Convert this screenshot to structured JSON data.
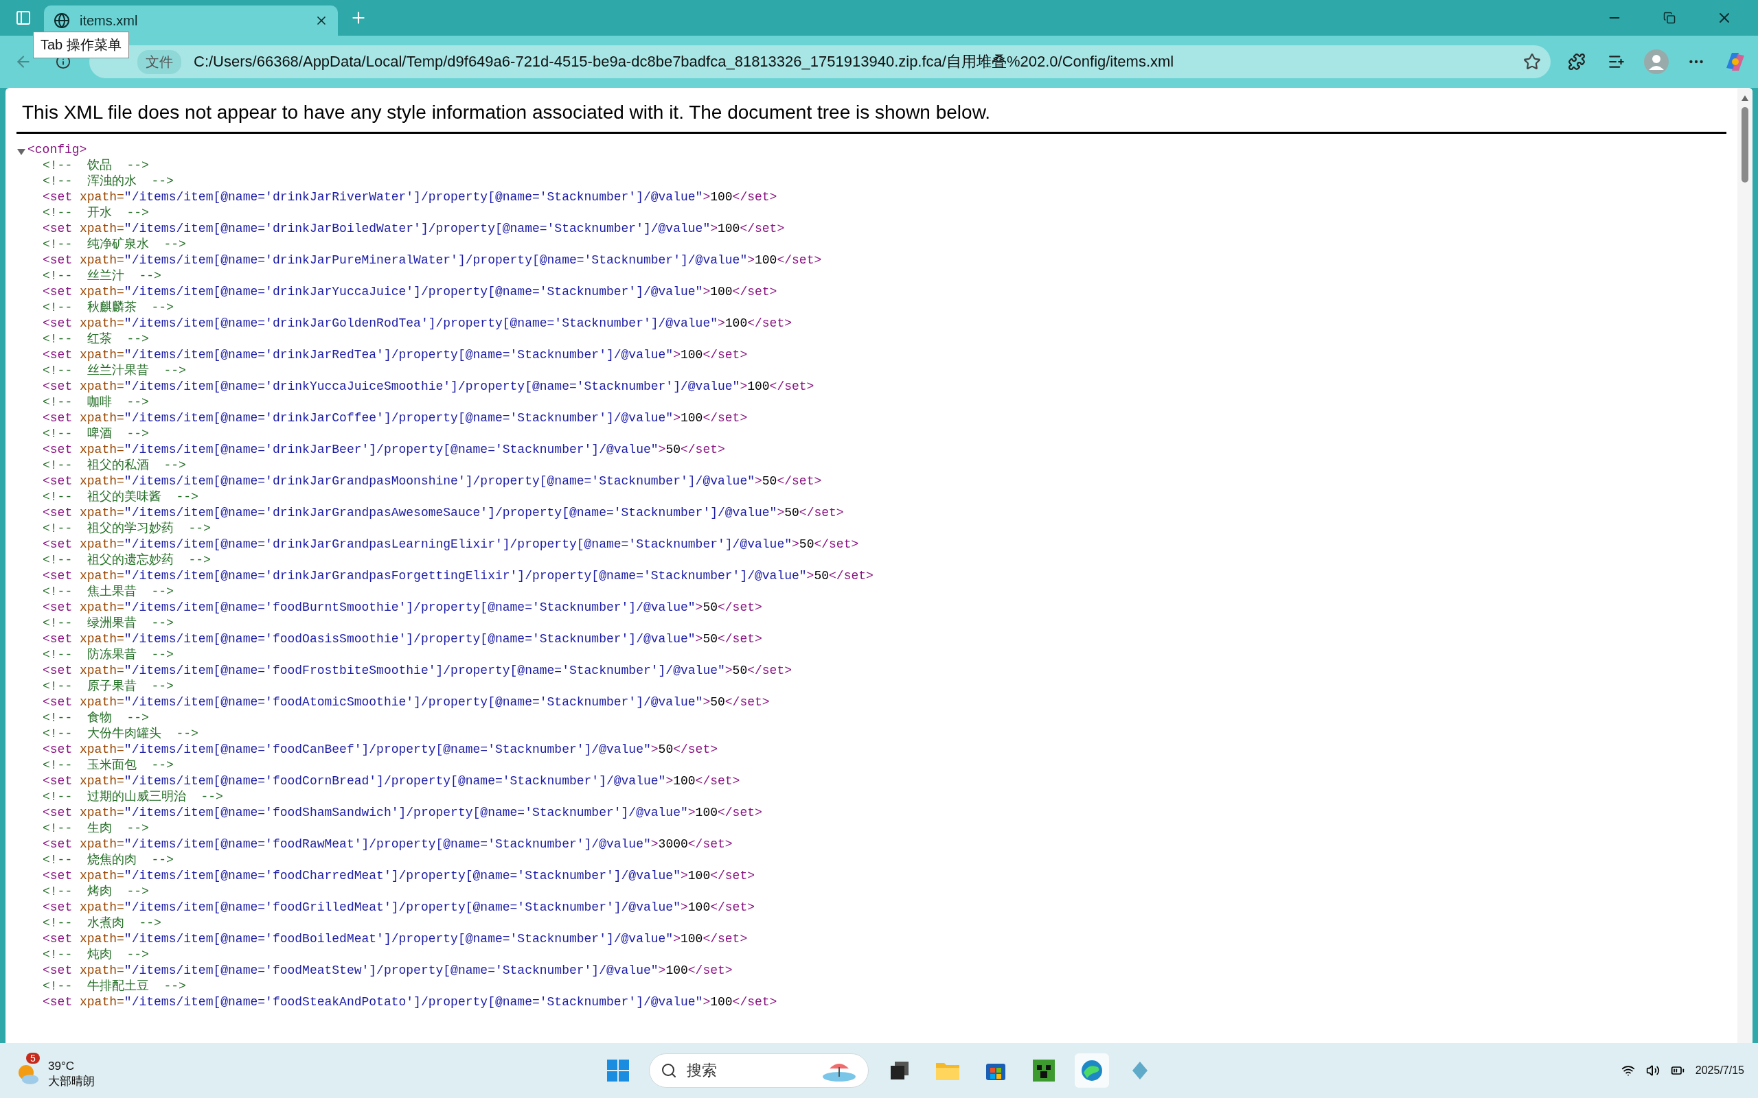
{
  "browser": {
    "tab": {
      "title": "items.xml",
      "selected": true
    },
    "tooltip": "Tab 操作菜单",
    "address": {
      "chip": "文件",
      "url": "C:/Users/66368/AppData/Local/Temp/d9f649a6-721d-4515-be9a-dc8be7badfca_81813326_1751913940.zip.fca/自用堆叠%202.0/Config/items.xml"
    }
  },
  "page": {
    "notice": "This XML file does not appear to have any style information associated with it. The document tree is shown below.",
    "tree": [
      {
        "kind": "element",
        "text": "<config>",
        "expanded": true,
        "children": [
          {
            "kind": "comment",
            "text": "<!--  饮品  -->"
          },
          {
            "kind": "comment",
            "text": "<!--  浑浊的水  -->"
          },
          {
            "kind": "set",
            "tag": "<set",
            "attr": " xpath=",
            "xpath": "\"/items/item[@name='drinkJarRiverWater']/property[@name='Stacknumber']/@value\"",
            "gt": ">",
            "value": "100",
            "close": "</set>"
          },
          {
            "kind": "comment",
            "text": "<!--  开水  -->"
          },
          {
            "kind": "set",
            "tag": "<set",
            "attr": " xpath=",
            "xpath": "\"/items/item[@name='drinkJarBoiledWater']/property[@name='Stacknumber']/@value\"",
            "gt": ">",
            "value": "100",
            "close": "</set>"
          },
          {
            "kind": "comment",
            "text": "<!--  纯净矿泉水  -->"
          },
          {
            "kind": "set",
            "tag": "<set",
            "attr": " xpath=",
            "xpath": "\"/items/item[@name='drinkJarPureMineralWater']/property[@name='Stacknumber']/@value\"",
            "gt": ">",
            "value": "100",
            "close": "</set>"
          },
          {
            "kind": "comment",
            "text": "<!--  丝兰汁  -->"
          },
          {
            "kind": "set",
            "tag": "<set",
            "attr": " xpath=",
            "xpath": "\"/items/item[@name='drinkJarYuccaJuice']/property[@name='Stacknumber']/@value\"",
            "gt": ">",
            "value": "100",
            "close": "</set>"
          },
          {
            "kind": "comment",
            "text": "<!--  秋麒麟茶  -->"
          },
          {
            "kind": "set",
            "tag": "<set",
            "attr": " xpath=",
            "xpath": "\"/items/item[@name='drinkJarGoldenRodTea']/property[@name='Stacknumber']/@value\"",
            "gt": ">",
            "value": "100",
            "close": "</set>"
          },
          {
            "kind": "comment",
            "text": "<!--  红茶  -->"
          },
          {
            "kind": "set",
            "tag": "<set",
            "attr": " xpath=",
            "xpath": "\"/items/item[@name='drinkJarRedTea']/property[@name='Stacknumber']/@value\"",
            "gt": ">",
            "value": "100",
            "close": "</set>"
          },
          {
            "kind": "comment",
            "text": "<!--  丝兰汁果昔  -->"
          },
          {
            "kind": "set",
            "tag": "<set",
            "attr": " xpath=",
            "xpath": "\"/items/item[@name='drinkYuccaJuiceSmoothie']/property[@name='Stacknumber']/@value\"",
            "gt": ">",
            "value": "100",
            "close": "</set>"
          },
          {
            "kind": "comment",
            "text": "<!--  咖啡  -->"
          },
          {
            "kind": "set",
            "tag": "<set",
            "attr": " xpath=",
            "xpath": "\"/items/item[@name='drinkJarCoffee']/property[@name='Stacknumber']/@value\"",
            "gt": ">",
            "value": "100",
            "close": "</set>"
          },
          {
            "kind": "comment",
            "text": "<!--  啤酒  -->"
          },
          {
            "kind": "set",
            "tag": "<set",
            "attr": " xpath=",
            "xpath": "\"/items/item[@name='drinkJarBeer']/property[@name='Stacknumber']/@value\"",
            "gt": ">",
            "value": "50",
            "close": "</set>"
          },
          {
            "kind": "comment",
            "text": "<!--  祖父的私酒  -->"
          },
          {
            "kind": "set",
            "tag": "<set",
            "attr": " xpath=",
            "xpath": "\"/items/item[@name='drinkJarGrandpasMoonshine']/property[@name='Stacknumber']/@value\"",
            "gt": ">",
            "value": "50",
            "close": "</set>"
          },
          {
            "kind": "comment",
            "text": "<!--  祖父的美味酱  -->"
          },
          {
            "kind": "set",
            "tag": "<set",
            "attr": " xpath=",
            "xpath": "\"/items/item[@name='drinkJarGrandpasAwesomeSauce']/property[@name='Stacknumber']/@value\"",
            "gt": ">",
            "value": "50",
            "close": "</set>"
          },
          {
            "kind": "comment",
            "text": "<!--  祖父的学习妙药  -->"
          },
          {
            "kind": "set",
            "tag": "<set",
            "attr": " xpath=",
            "xpath": "\"/items/item[@name='drinkJarGrandpasLearningElixir']/property[@name='Stacknumber']/@value\"",
            "gt": ">",
            "value": "50",
            "close": "</set>"
          },
          {
            "kind": "comment",
            "text": "<!--  祖父的遗忘妙药  -->"
          },
          {
            "kind": "set",
            "tag": "<set",
            "attr": " xpath=",
            "xpath": "\"/items/item[@name='drinkJarGrandpasForgettingElixir']/property[@name='Stacknumber']/@value\"",
            "gt": ">",
            "value": "50",
            "close": "</set>"
          },
          {
            "kind": "comment",
            "text": "<!--  焦土果昔  -->"
          },
          {
            "kind": "set",
            "tag": "<set",
            "attr": " xpath=",
            "xpath": "\"/items/item[@name='foodBurntSmoothie']/property[@name='Stacknumber']/@value\"",
            "gt": ">",
            "value": "50",
            "close": "</set>"
          },
          {
            "kind": "comment",
            "text": "<!--  绿洲果昔  -->"
          },
          {
            "kind": "set",
            "tag": "<set",
            "attr": " xpath=",
            "xpath": "\"/items/item[@name='foodOasisSmoothie']/property[@name='Stacknumber']/@value\"",
            "gt": ">",
            "value": "50",
            "close": "</set>"
          },
          {
            "kind": "comment",
            "text": "<!--  防冻果昔  -->"
          },
          {
            "kind": "set",
            "tag": "<set",
            "attr": " xpath=",
            "xpath": "\"/items/item[@name='foodFrostbiteSmoothie']/property[@name='Stacknumber']/@value\"",
            "gt": ">",
            "value": "50",
            "close": "</set>"
          },
          {
            "kind": "comment",
            "text": "<!--  原子果昔  -->"
          },
          {
            "kind": "set",
            "tag": "<set",
            "attr": " xpath=",
            "xpath": "\"/items/item[@name='foodAtomicSmoothie']/property[@name='Stacknumber']/@value\"",
            "gt": ">",
            "value": "50",
            "close": "</set>"
          },
          {
            "kind": "comment",
            "text": "<!--  食物  -->"
          },
          {
            "kind": "comment",
            "text": "<!--  大份牛肉罐头  -->"
          },
          {
            "kind": "set",
            "tag": "<set",
            "attr": " xpath=",
            "xpath": "\"/items/item[@name='foodCanBeef']/property[@name='Stacknumber']/@value\"",
            "gt": ">",
            "value": "50",
            "close": "</set>"
          },
          {
            "kind": "comment",
            "text": "<!--  玉米面包  -->"
          },
          {
            "kind": "set",
            "tag": "<set",
            "attr": " xpath=",
            "xpath": "\"/items/item[@name='foodCornBread']/property[@name='Stacknumber']/@value\"",
            "gt": ">",
            "value": "100",
            "close": "</set>"
          },
          {
            "kind": "comment",
            "text": "<!--  过期的山威三明治  -->"
          },
          {
            "kind": "set",
            "tag": "<set",
            "attr": " xpath=",
            "xpath": "\"/items/item[@name='foodShamSandwich']/property[@name='Stacknumber']/@value\"",
            "gt": ">",
            "value": "100",
            "close": "</set>"
          },
          {
            "kind": "comment",
            "text": "<!--  生肉  -->"
          },
          {
            "kind": "set",
            "tag": "<set",
            "attr": " xpath=",
            "xpath": "\"/items/item[@name='foodRawMeat']/property[@name='Stacknumber']/@value\"",
            "gt": ">",
            "value": "3000",
            "close": "</set>"
          },
          {
            "kind": "comment",
            "text": "<!--  烧焦的肉  -->"
          },
          {
            "kind": "set",
            "tag": "<set",
            "attr": " xpath=",
            "xpath": "\"/items/item[@name='foodCharredMeat']/property[@name='Stacknumber']/@value\"",
            "gt": ">",
            "value": "100",
            "close": "</set>"
          },
          {
            "kind": "comment",
            "text": "<!--  烤肉  -->"
          },
          {
            "kind": "set",
            "tag": "<set",
            "attr": " xpath=",
            "xpath": "\"/items/item[@name='foodGrilledMeat']/property[@name='Stacknumber']/@value\"",
            "gt": ">",
            "value": "100",
            "close": "</set>"
          },
          {
            "kind": "comment",
            "text": "<!--  水煮肉  -->"
          },
          {
            "kind": "set",
            "tag": "<set",
            "attr": " xpath=",
            "xpath": "\"/items/item[@name='foodBoiledMeat']/property[@name='Stacknumber']/@value\"",
            "gt": ">",
            "value": "100",
            "close": "</set>"
          },
          {
            "kind": "comment",
            "text": "<!--  炖肉  -->"
          },
          {
            "kind": "set",
            "tag": "<set",
            "attr": " xpath=",
            "xpath": "\"/items/item[@name='foodMeatStew']/property[@name='Stacknumber']/@value\"",
            "gt": ">",
            "value": "100",
            "close": "</set>"
          },
          {
            "kind": "comment",
            "text": "<!--  牛排配土豆  -->"
          },
          {
            "kind": "set",
            "tag": "<set",
            "attr": " xpath=",
            "xpath": "\"/items/item[@name='foodSteakAndPotato']/property[@name='Stacknumber']/@value\"",
            "gt": ">",
            "value": "100",
            "close": "</set>"
          }
        ]
      }
    ]
  },
  "taskbar": {
    "weather": {
      "badge": "5",
      "temperature": "39°C",
      "condition": "大部晴朗"
    },
    "search": {
      "placeholder": "搜索"
    },
    "date": "2025/7/15"
  }
}
